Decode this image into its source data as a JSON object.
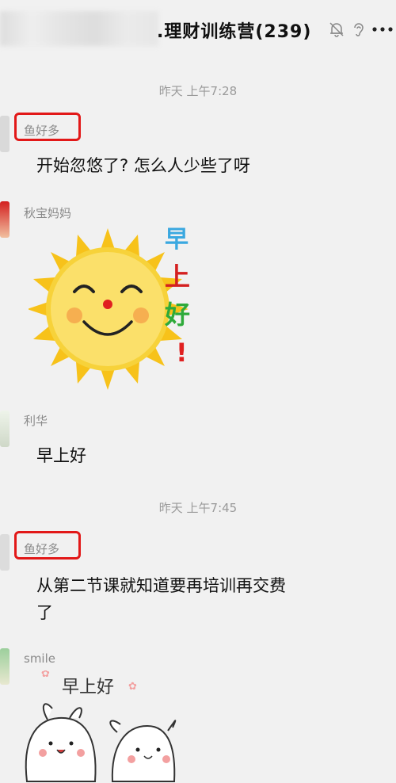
{
  "header": {
    "title": ".理财训练营(239)",
    "icons": [
      "mute-bell-icon",
      "ear-icon",
      "more-icon"
    ]
  },
  "chat": {
    "time_1": "昨天 上午7:28",
    "time_2": "昨天 上午7:45",
    "messages": [
      {
        "sender": "鱼好多",
        "text": "开始忽悠了? 怎么人少些了呀",
        "highlighted": true
      },
      {
        "sender": "秋宝妈妈",
        "sticker": "sun-good-morning-sticker",
        "sticker_text": [
          "早",
          "上",
          "好",
          "!"
        ]
      },
      {
        "sender": "利华",
        "text": "早上好"
      },
      {
        "sender": "鱼好多",
        "text_line1": "从第二节课就知道要再培训再交费",
        "text_line2": "了",
        "highlighted": true
      },
      {
        "sender": "smile",
        "sticker": "cute-bunnies-good-morning-sticker",
        "sticker_text": "早上好"
      }
    ]
  },
  "colors": {
    "highlight": "#e21818",
    "background": "#f1f1f1"
  }
}
